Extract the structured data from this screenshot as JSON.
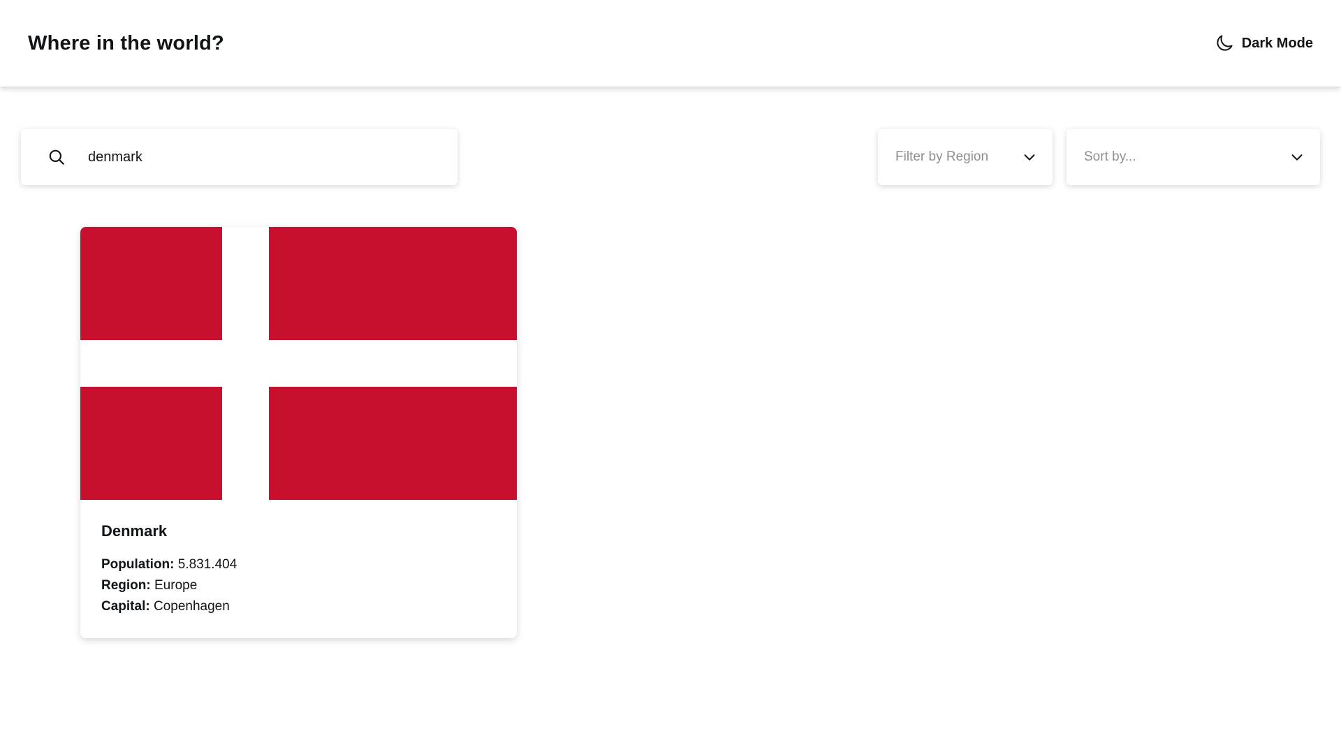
{
  "header": {
    "title": "Where in the world?",
    "theme_toggle_label": "Dark Mode"
  },
  "search": {
    "value": "denmark",
    "placeholder": ""
  },
  "filters": {
    "region_label": "Filter by Region",
    "sort_label": "Sort by..."
  },
  "countries": [
    {
      "name": "Denmark",
      "population_label": "Population:",
      "population": "5.831.404",
      "region_label": "Region:",
      "region": "Europe",
      "capital_label": "Capital:",
      "capital": "Copenhagen",
      "flag_colors": {
        "primary": "#c8102e",
        "cross": "#ffffff"
      }
    }
  ],
  "icons": {
    "theme": "moon-icon",
    "search": "search-icon",
    "dropdown": "chevron-down-icon"
  }
}
